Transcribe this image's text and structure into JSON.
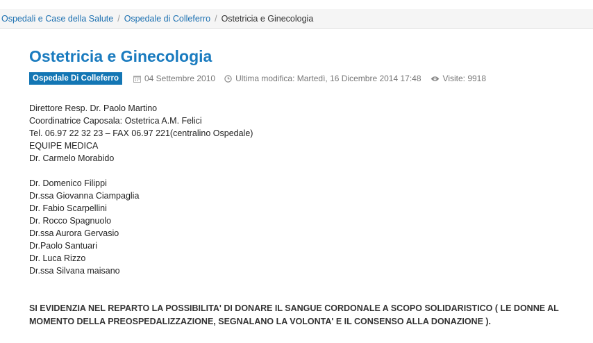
{
  "breadcrumb": {
    "items": [
      "Ospedali e Case della Salute",
      "Ospedale di Colleferro"
    ],
    "separator": "/",
    "current": "Ostetricia e Ginecologia"
  },
  "article": {
    "title": "Ostetricia e Ginecologia",
    "category_badge": "Ospedale Di Colleferro",
    "published": "04 Settembre 2010",
    "modified": "Ultima modifica: Martedì, 16 Dicembre 2014 17:48",
    "hits": "Visite: 9918",
    "staff_header": [
      "Direttore Resp. Dr. Paolo Martino",
      "Coordinatrice Caposala: Ostetrica A.M. Felici",
      "Tel. 06.97 22 32 23 – FAX 06.97 221(centralino Ospedale)",
      "EQUIPE MEDICA",
      "Dr. Carmelo Morabido"
    ],
    "staff_list": [
      "Dr. Domenico Filippi",
      "Dr.ssa Giovanna Ciampaglia",
      "Dr. Fabio Scarpellini",
      "Dr. Rocco Spagnuolo",
      "Dr.ssa Aurora Gervasio",
      "Dr.Paolo Santuari",
      "Dr. Luca Rizzo",
      "Dr.ssa Silvana maisano"
    ],
    "notice": "SI EVIDENZIA NEL REPARTO LA POSSIBILITA' DI DONARE IL SANGUE CORDONALE A SCOPO SOLIDARISTICO ( LE DONNE AL MOMENTO DELLA PREOSPEDALIZZAZIONE, SEGNALANO LA VOLONTA' E IL CONSENSO ALLA DONAZIONE )."
  },
  "icons": {
    "published": "calendar-icon",
    "modified": "clock-icon",
    "hits": "eye-icon"
  },
  "colors": {
    "title": "#1a7bbf",
    "link": "#1a6fb0",
    "badge_bg": "#1376b4",
    "breadcrumb_bg": "#f5f5f5"
  }
}
